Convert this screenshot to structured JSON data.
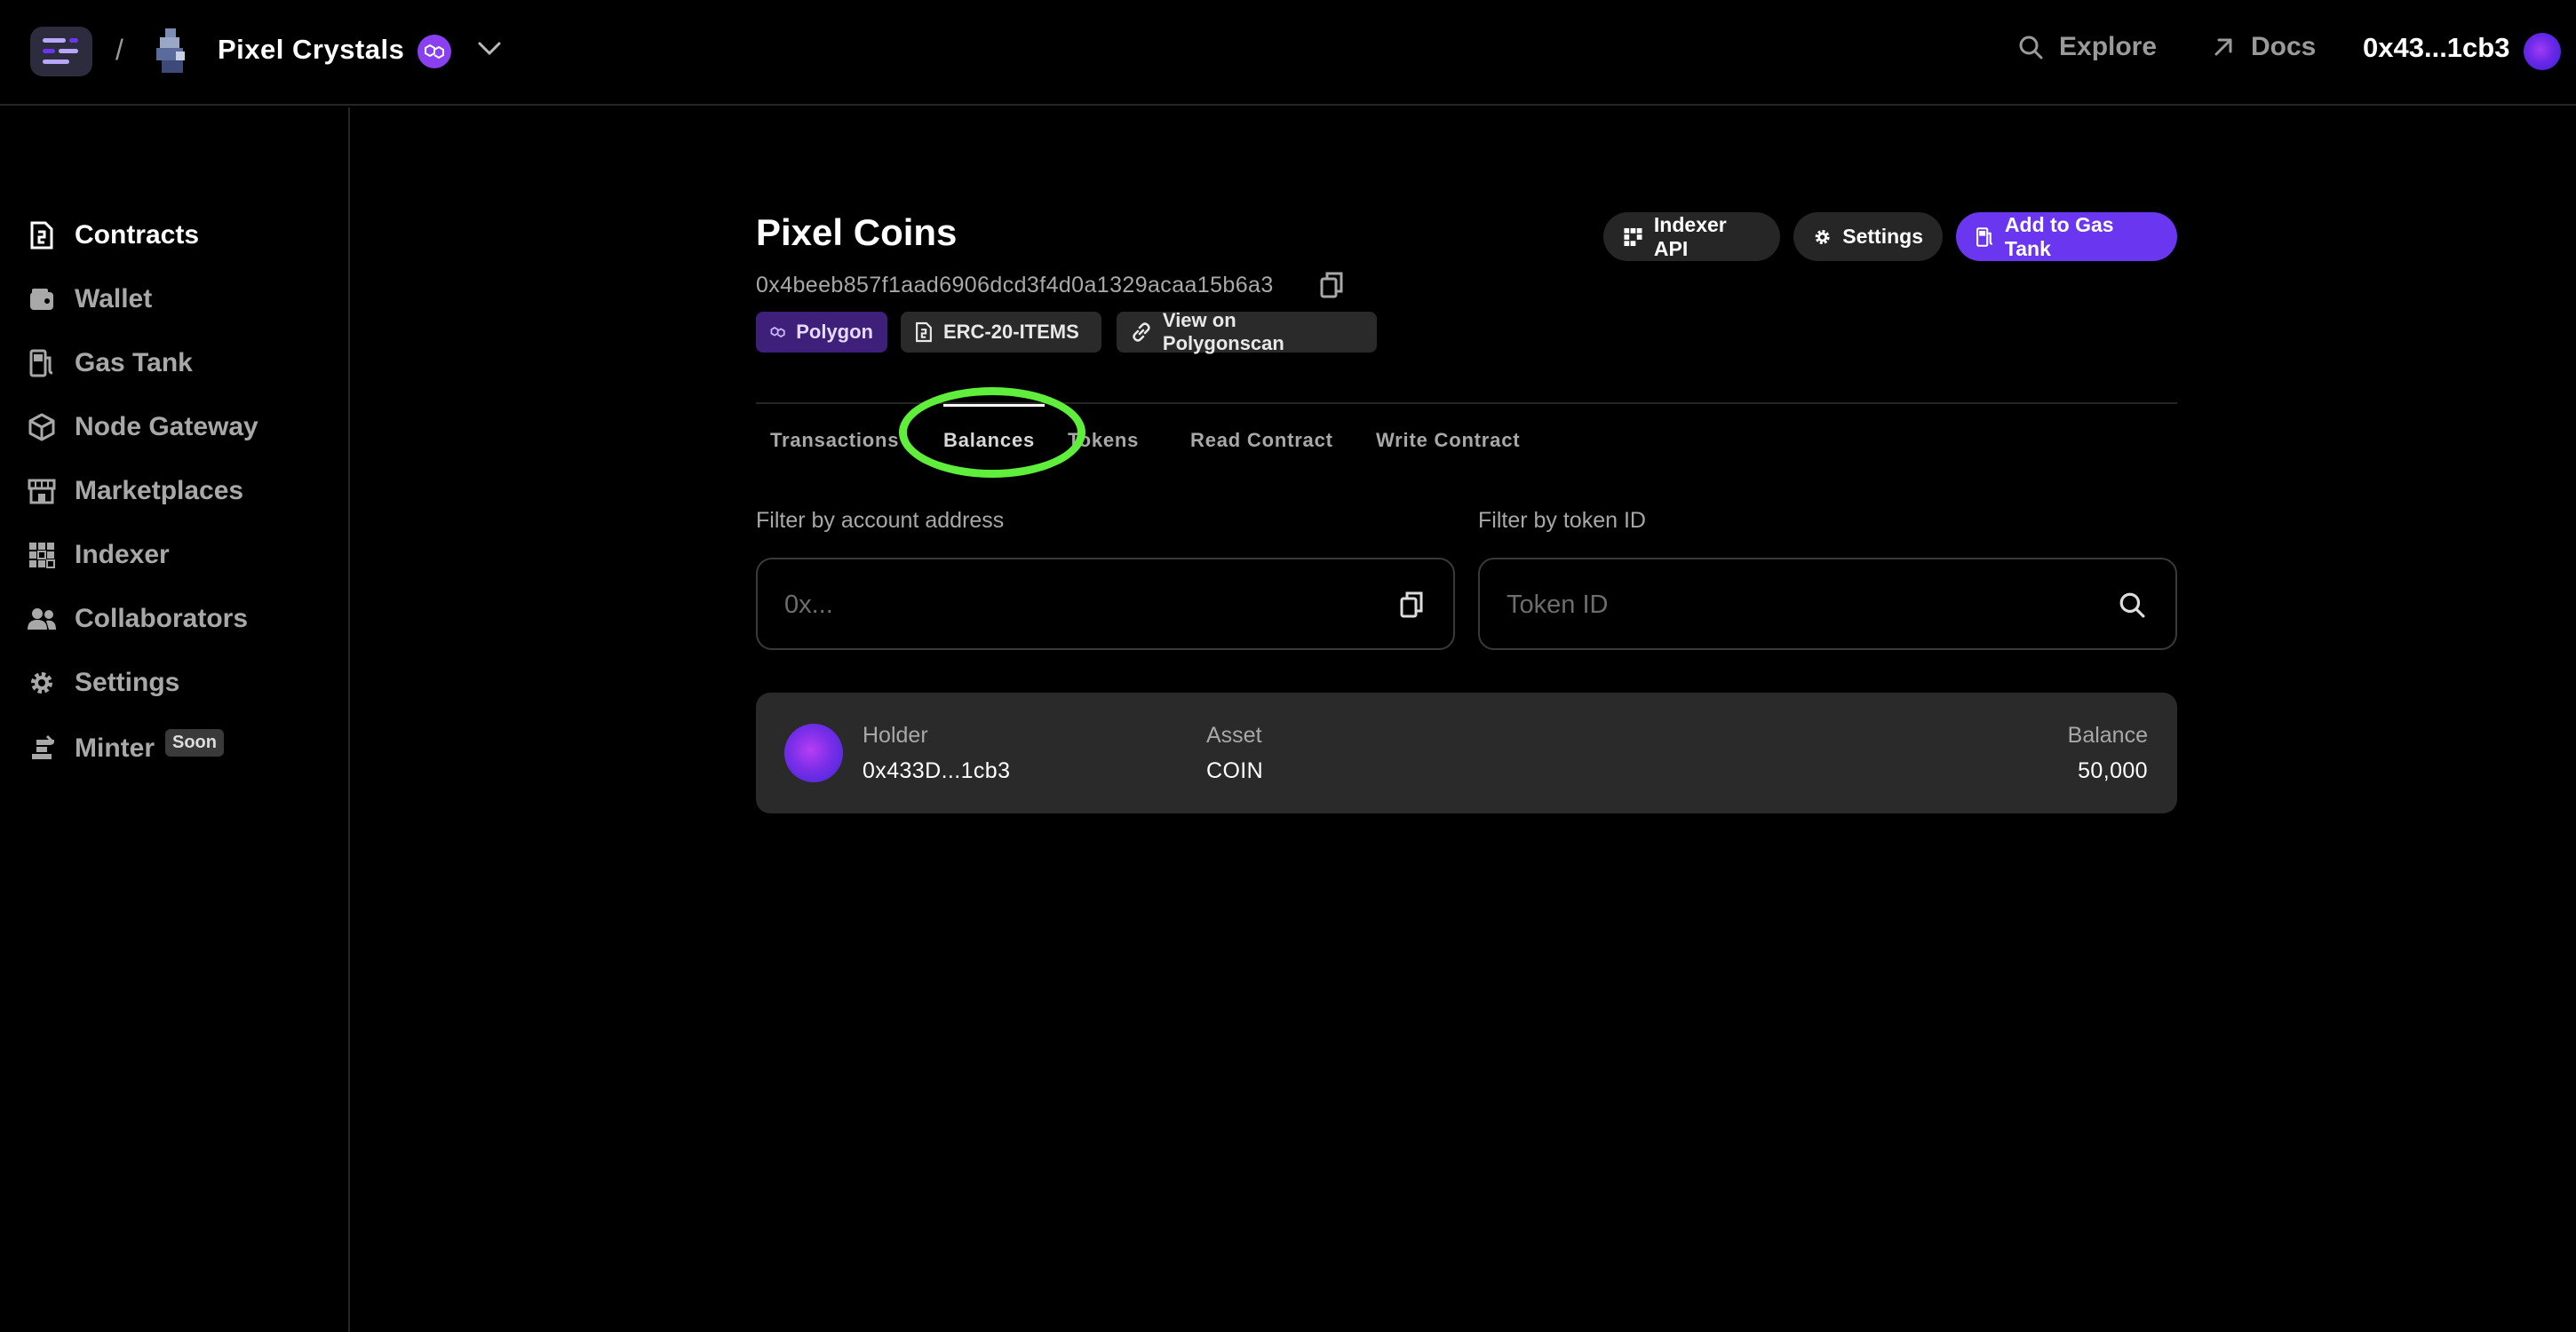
{
  "topbar": {
    "breadcrumb_separator": "/",
    "project_name": "Pixel Crystals",
    "explore_label": "Explore",
    "docs_label": "Docs",
    "wallet_address": "0x43...1cb3"
  },
  "sidebar": {
    "items": [
      {
        "label": "Contracts",
        "icon": "contract-icon",
        "active": true
      },
      {
        "label": "Wallet",
        "icon": "wallet-icon",
        "active": false
      },
      {
        "label": "Gas Tank",
        "icon": "gas-tank-icon",
        "active": false
      },
      {
        "label": "Node Gateway",
        "icon": "cube-icon",
        "active": false
      },
      {
        "label": "Marketplaces",
        "icon": "storefront-icon",
        "active": false
      },
      {
        "label": "Indexer",
        "icon": "grid-icon",
        "active": false
      },
      {
        "label": "Collaborators",
        "icon": "users-icon",
        "active": false
      },
      {
        "label": "Settings",
        "icon": "gear-icon",
        "active": false
      },
      {
        "label": "Minter",
        "icon": "anvil-icon",
        "active": false,
        "badge": "Soon"
      }
    ]
  },
  "contract": {
    "title": "Pixel Coins",
    "address": "0x4beeb857f1aad6906dcd3f4d0a1329acaa15b6a3",
    "chips": {
      "network": "Polygon",
      "type": "ERC-20-ITEMS",
      "explorer": "View on Polygonscan"
    },
    "actions": {
      "indexer": "Indexer API",
      "settings": "Settings",
      "gas_tank": "Add to Gas Tank"
    }
  },
  "tabs": [
    {
      "label": "Transactions",
      "active": false
    },
    {
      "label": "Balances",
      "active": true
    },
    {
      "label": "Tokens",
      "active": false
    },
    {
      "label": "Read Contract",
      "active": false
    },
    {
      "label": "Write Contract",
      "active": false
    }
  ],
  "filters": {
    "account": {
      "label": "Filter by account address",
      "placeholder": "0x..."
    },
    "token": {
      "label": "Filter by token ID",
      "placeholder": "Token ID"
    }
  },
  "balances": {
    "headers": {
      "holder": "Holder",
      "asset": "Asset",
      "balance": "Balance"
    },
    "rows": [
      {
        "holder": "0x433D...1cb3",
        "asset": "COIN",
        "balance": "50,000"
      }
    ]
  },
  "colors": {
    "accent": "#6a36f0",
    "highlight": "#5fee3b",
    "background": "#000000"
  }
}
